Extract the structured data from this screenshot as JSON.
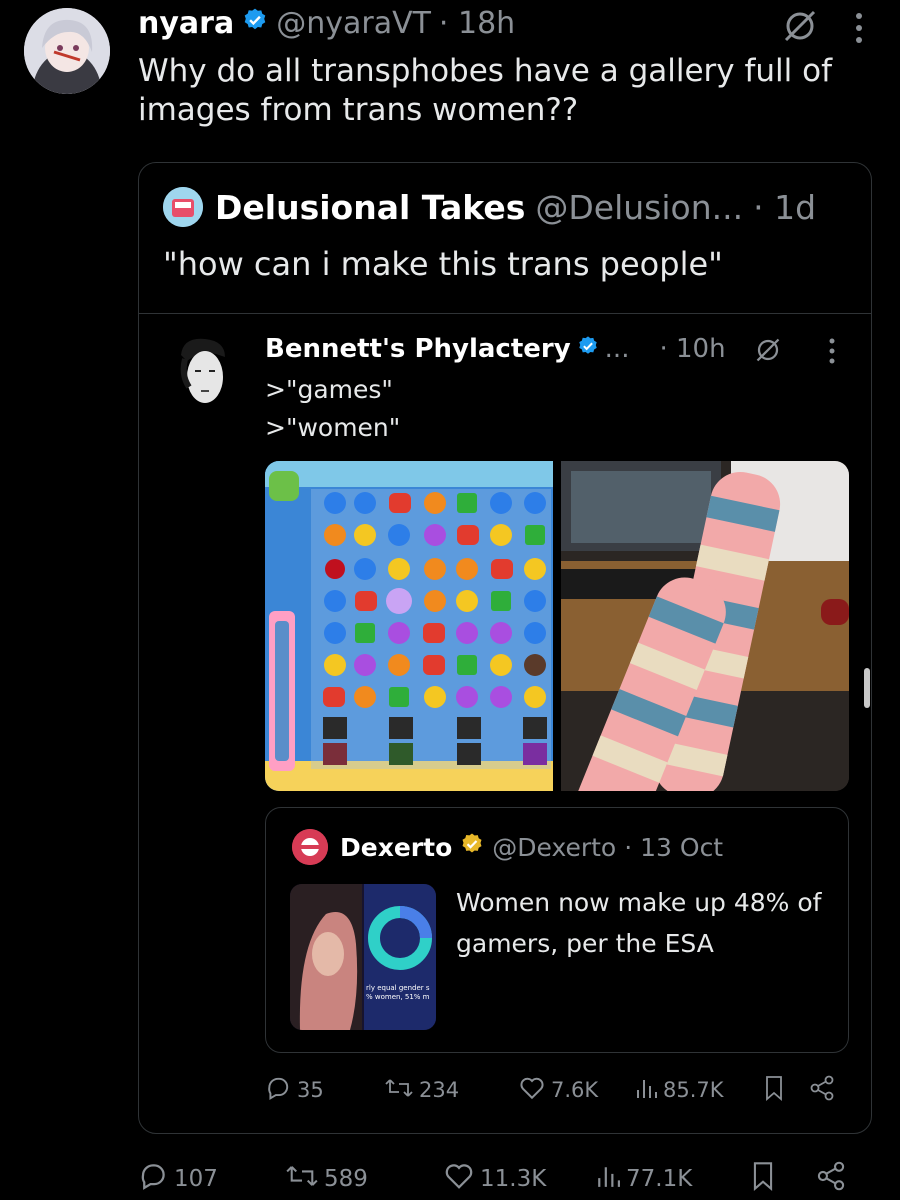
{
  "tweet": {
    "name": "nyara",
    "handle": "@nyaraVT",
    "time": "· 18h",
    "text": "Why do all transphobes have a gallery full of images from trans women??"
  },
  "quote": {
    "name": "Delusional Takes",
    "handle": "@Delusion...",
    "time": "· 1d",
    "text": "\"how can i make this trans people\"",
    "nested": {
      "name": "Bennett's Phylactery",
      "ellipsis": "...",
      "time": "· 10h",
      "line1": ">\"games\"",
      "line2": ">\"women\""
    },
    "card": {
      "name": "Dexerto",
      "handle": "@Dexerto",
      "time": "· 13 Oct",
      "text": "Women now make up 48% of gamers, per the ESA",
      "thumb_caption_1": "rly equal gender s",
      "thumb_caption_2": "% women, 51% m"
    },
    "actions": {
      "replies": "35",
      "reposts": "234",
      "likes": "7.6K",
      "views": "85.7K"
    }
  },
  "actions": {
    "replies": "107",
    "reposts": "589",
    "likes": "11.3K",
    "views": "77.1K"
  },
  "colors": {
    "background": "#000000",
    "text": "#e7e9ea",
    "muted": "#8b9096",
    "border": "#2f3336",
    "verified_blue": "#1d9bf0",
    "verified_gold": "#e8b829"
  },
  "icons": [
    "grok-icon",
    "more-icon",
    "verified-badge-icon",
    "gold-verified-badge-icon",
    "reply-icon",
    "repost-icon",
    "like-icon",
    "views-icon",
    "bookmark-icon",
    "share-icon"
  ]
}
